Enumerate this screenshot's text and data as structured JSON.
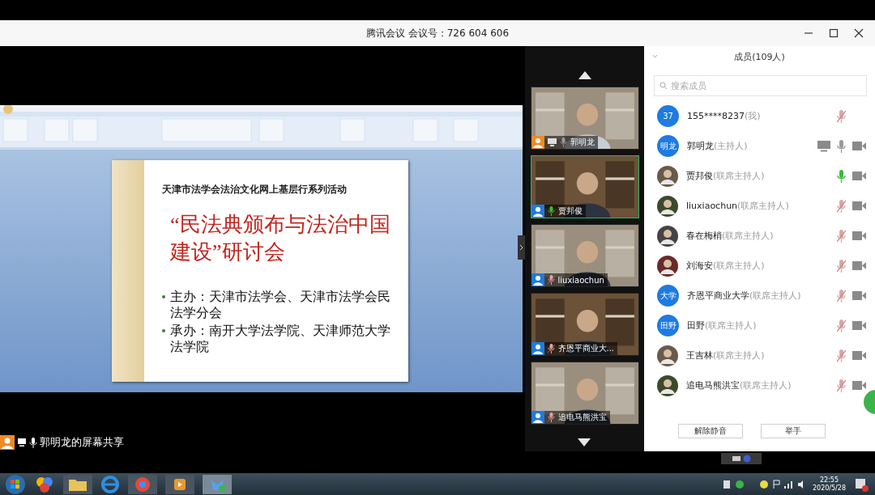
{
  "window": {
    "title": "腾讯会议 会议号：726 604 606"
  },
  "shared_screen": {
    "slide": {
      "subtitle": "天津市法学会法治文化网上基层行系列活动",
      "title": "“民法典颁布与法治中国建设”研讨会",
      "bullets": [
        "主办：天津市法学会、天津市法学会民法学分会",
        "承办：南开大学法学院、天津师范大学法学院"
      ]
    },
    "caption": "郭明龙的屏幕共享"
  },
  "video_tiles": [
    {
      "name": "郭明龙",
      "host": true,
      "sharing": true,
      "muted": false,
      "speaking": false,
      "selected": false
    },
    {
      "name": "贾邦俊",
      "host": false,
      "sharing": false,
      "muted": false,
      "speaking": true,
      "selected": true
    },
    {
      "name": "liuxiaochun",
      "host": false,
      "sharing": false,
      "muted": true,
      "speaking": false,
      "selected": false
    },
    {
      "name": "齐恩平商业大...",
      "host": false,
      "sharing": false,
      "muted": true,
      "speaking": false,
      "selected": false
    },
    {
      "name": "追电马熊洪宝",
      "host": false,
      "sharing": false,
      "muted": true,
      "speaking": false,
      "selected": false
    }
  ],
  "members": {
    "header": "成员(109人)",
    "search": {
      "placeholder": "搜索成员"
    },
    "items": [
      {
        "avatar": "37",
        "kind": "initials",
        "name": "155****8237",
        "role": "(我)",
        "sharing": false,
        "muted": true,
        "speaking": false,
        "video": false
      },
      {
        "avatar": "明龙",
        "kind": "initials",
        "name": "郭明龙",
        "role": "(主持人)",
        "sharing": true,
        "muted": false,
        "speaking": false,
        "video": true
      },
      {
        "name": "贾邦俊",
        "role": "(联席主持人)",
        "sharing": false,
        "muted": false,
        "speaking": true,
        "video": true
      },
      {
        "name": "liuxiaochun",
        "role": "(联席主持人)",
        "sharing": false,
        "muted": true,
        "speaking": false,
        "video": true
      },
      {
        "name": "春在梅梢",
        "role": "(联席主持人)",
        "sharing": false,
        "muted": true,
        "speaking": false,
        "video": true
      },
      {
        "name": "刘海安",
        "role": "(联席主持人)",
        "sharing": false,
        "muted": true,
        "speaking": false,
        "video": true
      },
      {
        "avatar": "大学",
        "kind": "initials",
        "name": "齐恩平商业大学",
        "role": "(联席主持人)",
        "sharing": false,
        "muted": true,
        "speaking": false,
        "video": true
      },
      {
        "avatar": "田野",
        "kind": "initials",
        "name": "田野",
        "role": "(联席主持人)",
        "sharing": false,
        "muted": true,
        "speaking": false,
        "video": true
      },
      {
        "name": "王吉林",
        "role": "(联席主持人)",
        "sharing": false,
        "muted": true,
        "speaking": false,
        "video": true
      },
      {
        "name": "追电马熊洪宝",
        "role": "(联席主持人)",
        "sharing": false,
        "muted": true,
        "speaking": false,
        "video": true
      }
    ],
    "buttons": [
      "解除静音",
      "举手"
    ]
  },
  "taskbar": {
    "time": "22:55",
    "date": "2020/5/28"
  }
}
